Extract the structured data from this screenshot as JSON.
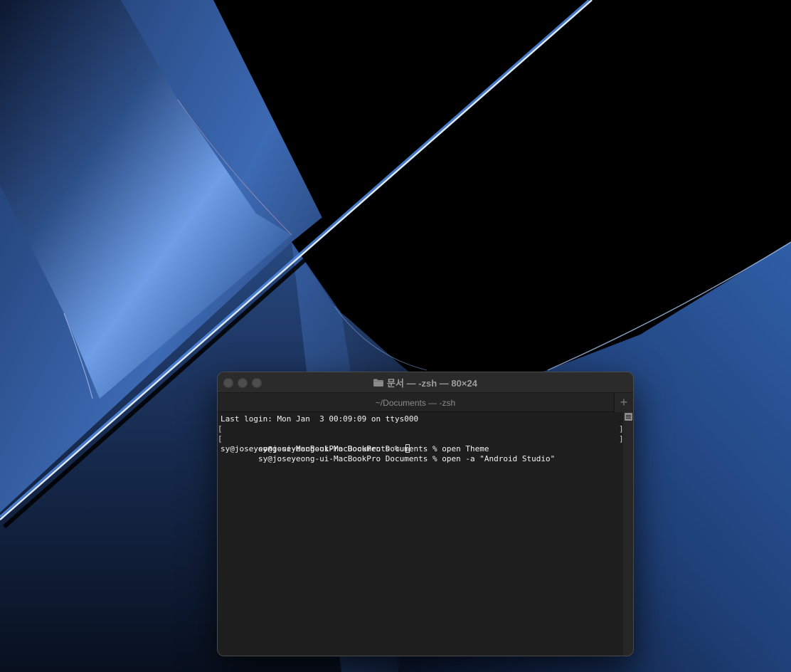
{
  "window": {
    "title": "문서 — -zsh — 80×24",
    "folder_icon": "folder-icon",
    "traffic_lights": [
      "close",
      "minimize",
      "zoom"
    ]
  },
  "tabbar": {
    "active_tab": "~/Documents — -zsh",
    "new_tab_label": "+"
  },
  "terminal": {
    "lines": [
      "Last login: Mon Jan  3 00:09:09 on ttys000",
      "sy@joseyeong-ui-MacBookPro Documents % open Theme",
      "sy@joseyeong-ui-MacBookPro Documents % open -a \"Android Studio\"",
      "sy@joseyeong-ui-MacBookPro Documents % "
    ],
    "mark_left": "[",
    "mark_right": "]"
  },
  "colors": {
    "window_bg": "#1e1e1e",
    "titlebar_bg": "#2b2b2b",
    "text": "#f2f2f2",
    "wallpaper_blue": "#4a7fd0"
  }
}
